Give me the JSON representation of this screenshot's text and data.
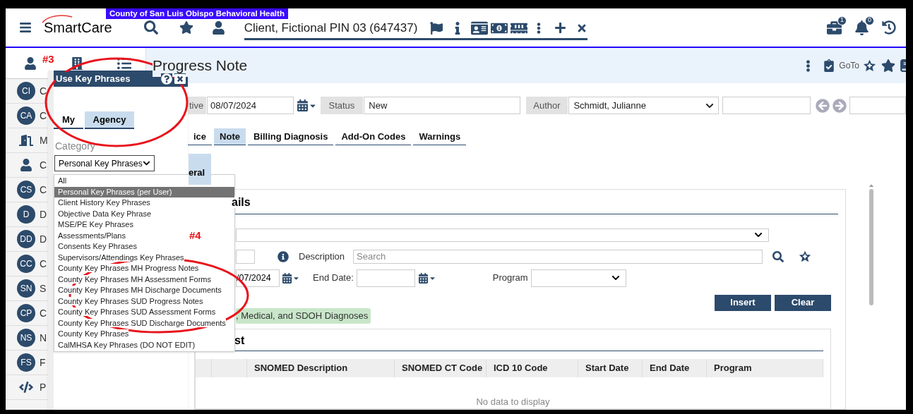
{
  "banner": "County of San Luis Obispo Behavioral Health",
  "header": {
    "logo": "SmartCare",
    "client": "Client, Fictional PIN 03 (647437)",
    "badges": [
      {
        "count": "1"
      },
      {
        "count": "0"
      }
    ]
  },
  "sidebar": {
    "items": [
      {
        "kind": "avatar",
        "initials": "CI",
        "label": "C"
      },
      {
        "kind": "avatar",
        "initials": "CA",
        "label": "C"
      },
      {
        "kind": "door",
        "label": "M"
      },
      {
        "kind": "person",
        "label": "C"
      },
      {
        "kind": "avatar",
        "initials": "CS",
        "label": "C"
      },
      {
        "kind": "avatar",
        "initials": "D",
        "label": "D"
      },
      {
        "kind": "avatar",
        "initials": "DD",
        "label": "D"
      },
      {
        "kind": "avatar",
        "initials": "CC",
        "label": "C"
      },
      {
        "kind": "avatar",
        "initials": "SN",
        "label": "S"
      },
      {
        "kind": "avatar",
        "initials": "CP",
        "label": "C"
      },
      {
        "kind": "avatar",
        "initials": "NS",
        "label": "N"
      },
      {
        "kind": "avatar",
        "initials": "FS",
        "label": "F"
      },
      {
        "kind": "code",
        "label": "P"
      }
    ]
  },
  "page": {
    "title": "Progress Note",
    "goto": "GoTo"
  },
  "form": {
    "effective_label": "tive",
    "effective_date": "08/07/2024",
    "status_label": "Status",
    "status": "New",
    "author_label": "Author",
    "author": "Schmidt, Julianne"
  },
  "tabs": [
    {
      "label": "ice",
      "selected": false
    },
    {
      "label": "Note",
      "selected": true
    },
    {
      "label": "Billing Diagnosis",
      "selected": false
    },
    {
      "label": "Add-On Codes",
      "selected": false
    },
    {
      "label": "Warnings",
      "selected": false
    }
  ],
  "sub_tab": {
    "label": "eral",
    "selected": true
  },
  "details": {
    "title": "ails",
    "description_label": "Description",
    "description_placeholder": "Search",
    "start_date": "/07/2024",
    "end_date_label": "End Date:",
    "program_label": "Program",
    "buttons": [
      "Insert",
      "Clear"
    ],
    "tag": ", Medical, and SDOH Diagnoses"
  },
  "list": {
    "title": "st",
    "columns": [
      "",
      "",
      "SNOMED Description",
      "SNOMED CT Code",
      "ICD 10 Code",
      "Start Date",
      "End Date",
      "Program"
    ],
    "empty": "No data to display"
  },
  "popup": {
    "title": "Use Key Phrases",
    "tabs": [
      {
        "label": "My",
        "selected": false
      },
      {
        "label": "Agency",
        "selected": true
      }
    ],
    "category_label": "Category",
    "category_value": "Personal Key Phrases",
    "options": [
      {
        "label": "All",
        "selected": false
      },
      {
        "label": "Personal Key Phrases (per User)",
        "selected": true
      },
      {
        "label": "Client History Key Phrases",
        "selected": false
      },
      {
        "label": "Objective Data Key Phrase",
        "selected": false
      },
      {
        "label": "MSE/PE Key Phrases",
        "selected": false
      },
      {
        "label": "Assessments/Plans",
        "selected": false
      },
      {
        "label": "Consents Key Phrases",
        "selected": false
      },
      {
        "label": "Supervisors/Attendings Key Phrases",
        "selected": false
      },
      {
        "label": "County Key Phrases MH Progress Notes",
        "selected": false
      },
      {
        "label": "County Key Phrases MH Assessment Forms",
        "selected": false
      },
      {
        "label": "County Key Phrases MH Discharge Documents",
        "selected": false
      },
      {
        "label": "County Key Phrases SUD Progress Notes",
        "selected": false
      },
      {
        "label": "County Key Phrases SUD Assessment Forms",
        "selected": false
      },
      {
        "label": "County Key Phrases SUD Discharge Documents",
        "selected": false
      },
      {
        "label": "County Key Phrases",
        "selected": false
      },
      {
        "label": "CalMHSA Key Phrases (DO NOT EDIT)",
        "selected": false
      }
    ]
  },
  "annotations": [
    {
      "label": "#3"
    },
    {
      "label": "#4"
    }
  ]
}
